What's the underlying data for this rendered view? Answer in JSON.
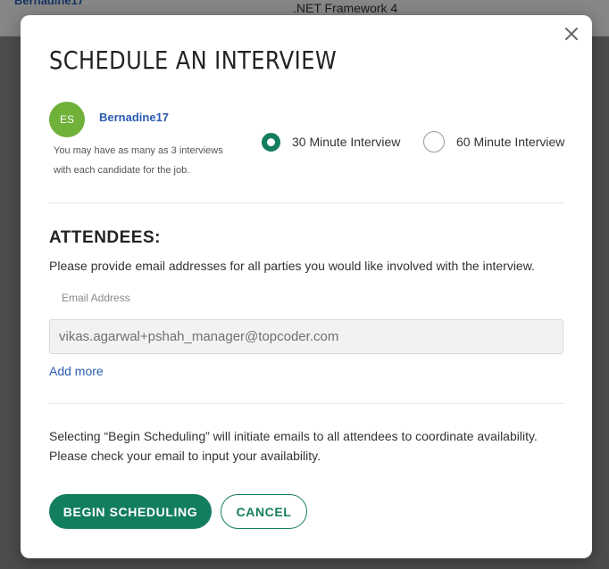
{
  "background": {
    "username": "Bernadine17",
    "framework": ".NET Framework 4"
  },
  "modal": {
    "title": "SCHEDULE AN INTERVIEW",
    "close_icon": "close-icon",
    "candidate": {
      "initials": "ES",
      "username": "Bernadine17",
      "note_line1": "You may have as many as 3 interviews",
      "note_line2": "with each candidate for the job."
    },
    "interview_options": [
      {
        "label": "30 Minute Interview",
        "selected": true
      },
      {
        "label": "60 Minute Interview",
        "selected": false
      }
    ],
    "attendees": {
      "heading": "ATTENDEES:",
      "instructions": "Please provide email addresses for all parties you would like involved with the interview.",
      "email_label": "Email Address",
      "email_value": "vikas.agarwal+pshah_manager@topcoder.com",
      "add_more": "Add more"
    },
    "info_line1": "Selecting “Begin Scheduling” will initiate emails to all attendees to coordinate availability.",
    "info_line2": "Please check your email to input your availability.",
    "buttons": {
      "begin": "BEGIN SCHEDULING",
      "cancel": "CANCEL"
    }
  },
  "colors": {
    "accent": "#137d60",
    "link": "#2a5db0",
    "avatar": "#6fb139"
  }
}
